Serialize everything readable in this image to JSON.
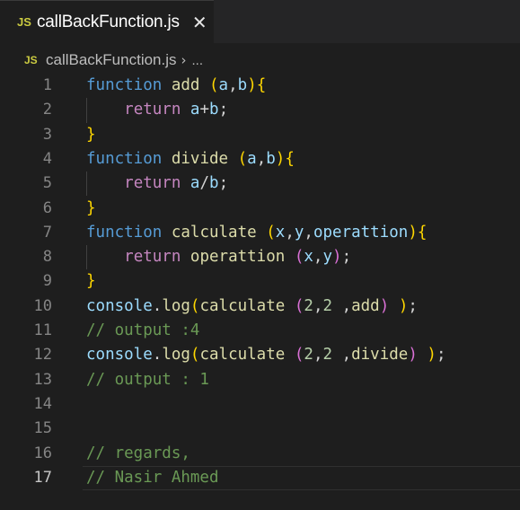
{
  "tab": {
    "badge": "JS",
    "label": "callBackFunction.js",
    "close_glyph": "✕"
  },
  "breadcrumb": {
    "badge": "JS",
    "file": "callBackFunction.js",
    "separator": "›",
    "more": "..."
  },
  "editor": {
    "active_line": 17,
    "lines": [
      {
        "n": "1",
        "tokens": [
          {
            "t": "function",
            "c": "kw"
          },
          {
            "t": " ",
            "c": "pl"
          },
          {
            "t": "add",
            "c": "fn"
          },
          {
            "t": " ",
            "c": "pl"
          },
          {
            "t": "(",
            "c": "b1"
          },
          {
            "t": "a",
            "c": "param"
          },
          {
            "t": ",",
            "c": "pl"
          },
          {
            "t": "b",
            "c": "param"
          },
          {
            "t": ")",
            "c": "b1"
          },
          {
            "t": "{",
            "c": "b1"
          }
        ]
      },
      {
        "n": "2",
        "tokens": [
          {
            "t": "    ",
            "c": "pl"
          },
          {
            "t": "return",
            "c": "ret"
          },
          {
            "t": " ",
            "c": "pl"
          },
          {
            "t": "a",
            "c": "param"
          },
          {
            "t": "+",
            "c": "pl"
          },
          {
            "t": "b",
            "c": "param"
          },
          {
            "t": ";",
            "c": "pl"
          }
        ]
      },
      {
        "n": "3",
        "tokens": [
          {
            "t": "}",
            "c": "b1"
          }
        ]
      },
      {
        "n": "4",
        "tokens": [
          {
            "t": "function",
            "c": "kw"
          },
          {
            "t": " ",
            "c": "pl"
          },
          {
            "t": "divide",
            "c": "fn"
          },
          {
            "t": " ",
            "c": "pl"
          },
          {
            "t": "(",
            "c": "b1"
          },
          {
            "t": "a",
            "c": "param"
          },
          {
            "t": ",",
            "c": "pl"
          },
          {
            "t": "b",
            "c": "param"
          },
          {
            "t": ")",
            "c": "b1"
          },
          {
            "t": "{",
            "c": "b1"
          }
        ]
      },
      {
        "n": "5",
        "tokens": [
          {
            "t": "    ",
            "c": "pl"
          },
          {
            "t": "return",
            "c": "ret"
          },
          {
            "t": " ",
            "c": "pl"
          },
          {
            "t": "a",
            "c": "param"
          },
          {
            "t": "/",
            "c": "pl"
          },
          {
            "t": "b",
            "c": "param"
          },
          {
            "t": ";",
            "c": "pl"
          }
        ]
      },
      {
        "n": "6",
        "tokens": [
          {
            "t": "}",
            "c": "b1"
          }
        ]
      },
      {
        "n": "7",
        "tokens": [
          {
            "t": "function",
            "c": "kw"
          },
          {
            "t": " ",
            "c": "pl"
          },
          {
            "t": "calculate",
            "c": "fn"
          },
          {
            "t": " ",
            "c": "pl"
          },
          {
            "t": "(",
            "c": "b1"
          },
          {
            "t": "x",
            "c": "param"
          },
          {
            "t": ",",
            "c": "pl"
          },
          {
            "t": "y",
            "c": "param"
          },
          {
            "t": ",",
            "c": "pl"
          },
          {
            "t": "operattion",
            "c": "param"
          },
          {
            "t": ")",
            "c": "b1"
          },
          {
            "t": "{",
            "c": "b1"
          }
        ]
      },
      {
        "n": "8",
        "tokens": [
          {
            "t": "    ",
            "c": "pl"
          },
          {
            "t": "return",
            "c": "ret"
          },
          {
            "t": " ",
            "c": "pl"
          },
          {
            "t": "operattion",
            "c": "fn"
          },
          {
            "t": " ",
            "c": "pl"
          },
          {
            "t": "(",
            "c": "b2"
          },
          {
            "t": "x",
            "c": "param"
          },
          {
            "t": ",",
            "c": "pl"
          },
          {
            "t": "y",
            "c": "param"
          },
          {
            "t": ")",
            "c": "b2"
          },
          {
            "t": ";",
            "c": "pl"
          }
        ]
      },
      {
        "n": "9",
        "tokens": [
          {
            "t": "}",
            "c": "b1"
          }
        ]
      },
      {
        "n": "10",
        "tokens": [
          {
            "t": "console",
            "c": "var"
          },
          {
            "t": ".",
            "c": "pl"
          },
          {
            "t": "log",
            "c": "fn"
          },
          {
            "t": "(",
            "c": "b1"
          },
          {
            "t": "calculate",
            "c": "fn"
          },
          {
            "t": " ",
            "c": "pl"
          },
          {
            "t": "(",
            "c": "b2"
          },
          {
            "t": "2",
            "c": "num"
          },
          {
            "t": ",",
            "c": "pl"
          },
          {
            "t": "2",
            "c": "num"
          },
          {
            "t": " ,",
            "c": "pl"
          },
          {
            "t": "add",
            "c": "fn"
          },
          {
            "t": ")",
            "c": "b2"
          },
          {
            "t": " ",
            "c": "pl"
          },
          {
            "t": ")",
            "c": "b1"
          },
          {
            "t": ";",
            "c": "pl"
          }
        ]
      },
      {
        "n": "11",
        "tokens": [
          {
            "t": "// output :4",
            "c": "cm"
          }
        ]
      },
      {
        "n": "12",
        "tokens": [
          {
            "t": "console",
            "c": "var"
          },
          {
            "t": ".",
            "c": "pl"
          },
          {
            "t": "log",
            "c": "fn"
          },
          {
            "t": "(",
            "c": "b1"
          },
          {
            "t": "calculate",
            "c": "fn"
          },
          {
            "t": " ",
            "c": "pl"
          },
          {
            "t": "(",
            "c": "b2"
          },
          {
            "t": "2",
            "c": "num"
          },
          {
            "t": ",",
            "c": "pl"
          },
          {
            "t": "2",
            "c": "num"
          },
          {
            "t": " ,",
            "c": "pl"
          },
          {
            "t": "divide",
            "c": "fn"
          },
          {
            "t": ")",
            "c": "b2"
          },
          {
            "t": " ",
            "c": "pl"
          },
          {
            "t": ")",
            "c": "b1"
          },
          {
            "t": ";",
            "c": "pl"
          }
        ]
      },
      {
        "n": "13",
        "tokens": [
          {
            "t": "// output : 1",
            "c": "cm"
          }
        ]
      },
      {
        "n": "14",
        "tokens": []
      },
      {
        "n": "15",
        "tokens": []
      },
      {
        "n": "16",
        "tokens": [
          {
            "t": "// regards,",
            "c": "cm"
          }
        ]
      },
      {
        "n": "17",
        "tokens": [
          {
            "t": "// Nasir Ahmed",
            "c": "cm"
          }
        ]
      }
    ]
  }
}
